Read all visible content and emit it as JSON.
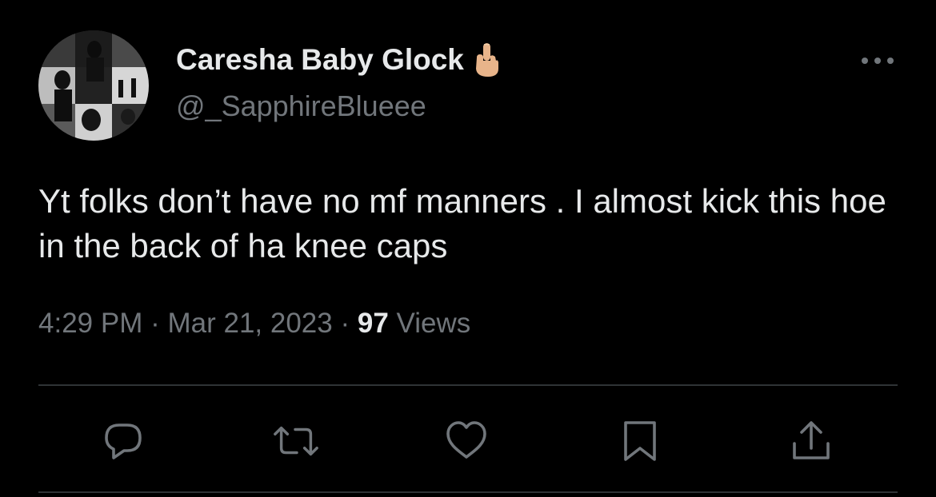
{
  "tweet": {
    "display_name": "Caresha Baby Glock",
    "name_emoji": "middle-finger-emoji",
    "handle": "@_SapphireBlueee",
    "text": "Yt folks don’t have no mf manners . I almost kick this hoe in the back of ha knee caps",
    "time": "4:29 PM",
    "date": "Mar 21, 2023",
    "separator": "·",
    "views_count": "97",
    "views_label": "Views"
  },
  "actions": {
    "reply_icon": "reply-icon",
    "retweet_icon": "retweet-icon",
    "like_icon": "like-icon",
    "bookmark_icon": "bookmark-icon",
    "share_icon": "share-icon"
  },
  "colors": {
    "background": "#000000",
    "primary_text": "#e7e9ea",
    "secondary_text": "#71767b",
    "divider": "#2f3336"
  }
}
